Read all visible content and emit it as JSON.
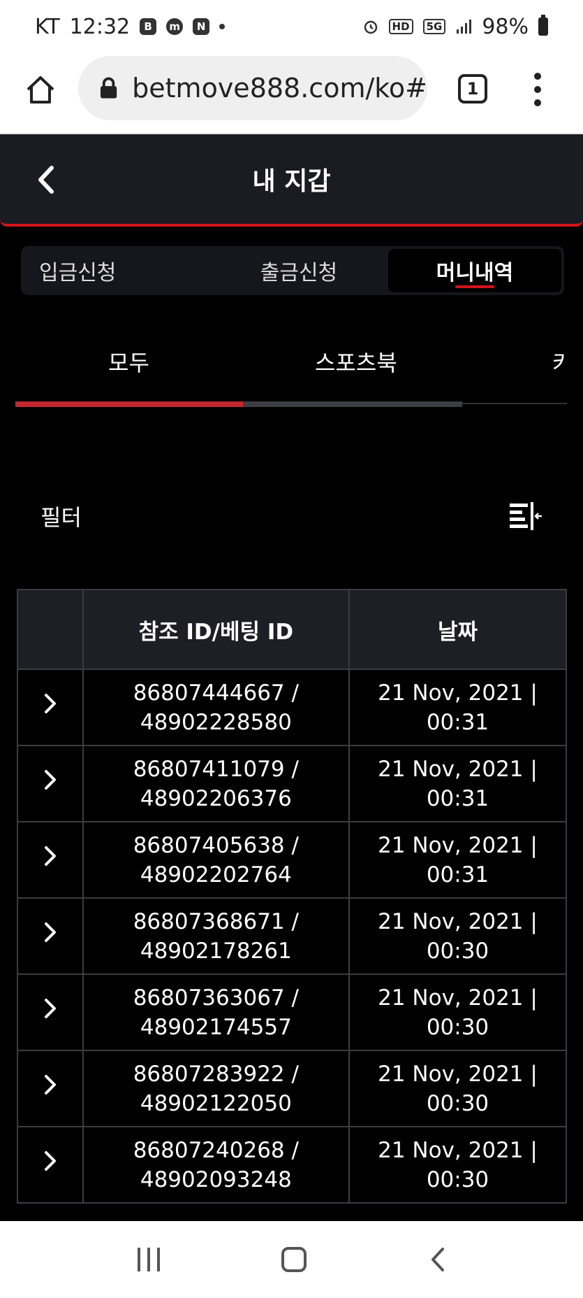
{
  "status_bar": {
    "carrier": "KT",
    "time": "12:32",
    "app_icons": [
      "B",
      "m",
      "N"
    ],
    "network_badges": [
      "HD",
      "5G"
    ],
    "battery": "98%"
  },
  "browser": {
    "url": "betmove888.com/ko#",
    "tab_count": "1"
  },
  "header": {
    "title": "내 지갑"
  },
  "main_tabs": [
    {
      "label": "입금신청"
    },
    {
      "label": "출금신청"
    },
    {
      "label": "머니내역"
    }
  ],
  "sub_tabs": [
    {
      "label": "모두"
    },
    {
      "label": "스포츠북"
    },
    {
      "label": "카"
    }
  ],
  "filter": {
    "label": "필터"
  },
  "table": {
    "headers": [
      "",
      "참조 ID/베팅 ID",
      "날짜"
    ],
    "rows": [
      {
        "ref": "86807444667 /",
        "bet": "48902228580",
        "date": "21 Nov, 2021 |",
        "time": "00:31"
      },
      {
        "ref": "86807411079 /",
        "bet": "48902206376",
        "date": "21 Nov, 2021 |",
        "time": "00:31"
      },
      {
        "ref": "86807405638 /",
        "bet": "48902202764",
        "date": "21 Nov, 2021 |",
        "time": "00:31"
      },
      {
        "ref": "86807368671 /",
        "bet": "48902178261",
        "date": "21 Nov, 2021 |",
        "time": "00:30"
      },
      {
        "ref": "86807363067 /",
        "bet": "48902174557",
        "date": "21 Nov, 2021 |",
        "time": "00:30"
      },
      {
        "ref": "86807283922 /",
        "bet": "48902122050",
        "date": "21 Nov, 2021 |",
        "time": "00:30"
      },
      {
        "ref": "86807240268 /",
        "bet": "48902093248",
        "date": "21 Nov, 2021 |",
        "time": "00:30"
      }
    ]
  },
  "colors": {
    "accent_red": "#d0141a",
    "header_bg": "#1b1c22",
    "page_bg": "#000000"
  }
}
